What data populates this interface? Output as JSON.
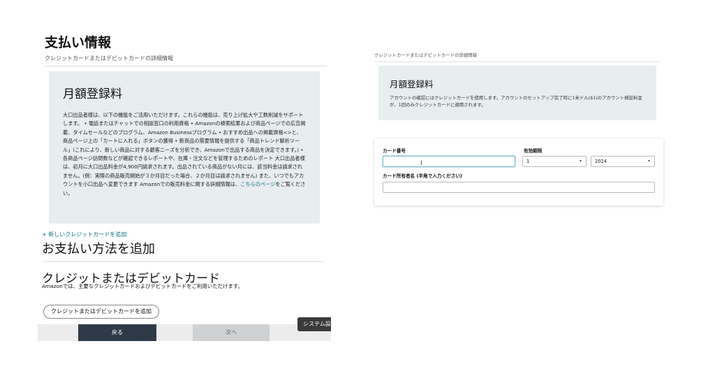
{
  "left": {
    "page_title": "支払い情報",
    "section_sub": "クレジットカードまたはデビットカードの詳細情報",
    "fee": {
      "title": "月額登録料",
      "body": "大口出品者様は、以下の機能をご活用いただけます。これらの機能は、売り上げ拡大や工数削減をサポートします。 • 電話またはチャットでの相談窓口の利用資格 • Amazonの検索結果および商品ページでの広告掲載、タイムセールなどのプログラム、Amazon Businessプログラム • おすすめ出品への掲載資格<>と、商品ページ上の「カートに入れる」ボタンの獲得 • 新商品の需要情報を提供する「商品トレンド解析ツール」(これにより、新しい商品に対する顧客ニーズを分析でき、Amazonで出品する商品を決定できます。) • 各商品ページ訪問数などが確認できるレポートや、在庫・注文などを管理するためのレポート 大口出品者様は、初月に大口出品料金が4,900円請求されます。出品されている商品がない月には、該当料金は請求されません。(例：実際の商品販売開始が３か月目だった場合、２か月目は請求されません) また、いつでもアカウントを小口出品へ変更できます Amazonでの販売料金に関する詳細情報は、",
      "link": "こちらのページ",
      "body_end": "をご覧ください。"
    },
    "add_card_link": "+ 新しいクレジットカードを追加",
    "add_payment_title": "お支払い方法を追加",
    "credit_title": "クレジットまたはデビットカード",
    "credit_desc": "Amazonでは、主要なクレジットカードおよびデビットカードをご利用いただけます。",
    "add_credit_button": "クレジットまたはデビットカードを追加",
    "back_button": "戻る",
    "next_button": "次へ",
    "system_tip": "システム設"
  },
  "right": {
    "section_sub": "クレジットカードまたはデビットカードの詳細情報",
    "fee": {
      "title": "月額登録料",
      "body": "アカウントの確認にはクレジットカードを使用します。アカウントのセットアップ完了時に1米ドル($1)のアカウント検証料金が、1回のみクレジットカードに適用されます。"
    },
    "form": {
      "card_number_label": "カード番号",
      "card_number_value": "",
      "expiry_label": "有効期限",
      "expiry_month": "1",
      "expiry_year": "2024",
      "holder_label": "カード所有者名 (半角で入力ください)",
      "holder_value": ""
    }
  },
  "icons": {
    "chevron": "chevron-down-icon",
    "cursor": "text-cursor-icon"
  }
}
